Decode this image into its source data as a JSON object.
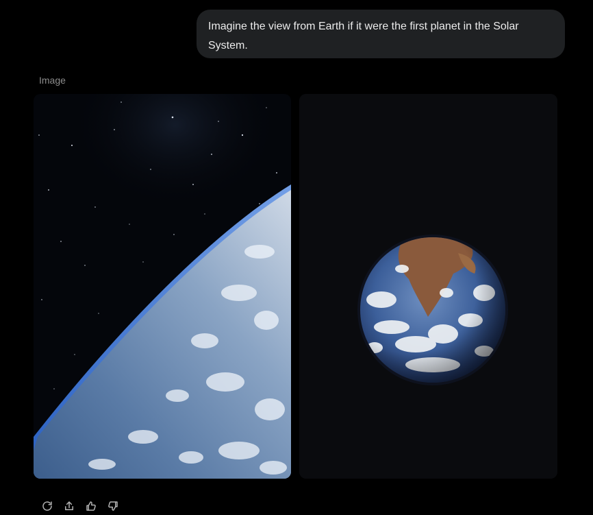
{
  "conversation": {
    "user_message": "Imagine the view from Earth if it were the first planet in the Solar System.",
    "section_label": "Image"
  },
  "images": [
    {
      "alt": "Earth limb from orbit with starfield"
    },
    {
      "alt": "Full Earth globe on black background"
    }
  ],
  "toolbar": {
    "icons": [
      "regenerate-icon",
      "share-icon",
      "thumbs-up-icon",
      "thumbs-down-icon"
    ]
  },
  "colors": {
    "background": "#000000",
    "bubble": "#1f2123",
    "text": "#ececec",
    "muted": "#8c8c8c"
  }
}
